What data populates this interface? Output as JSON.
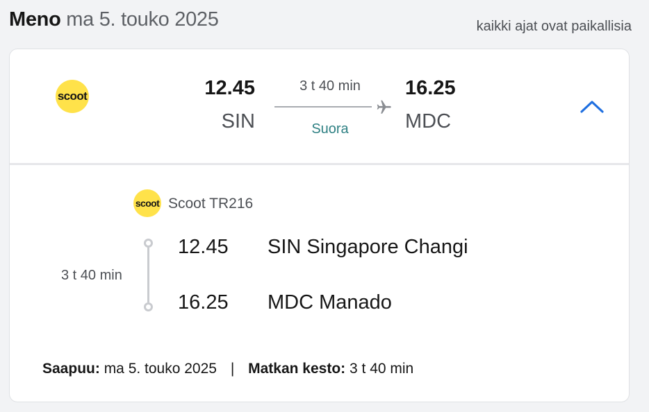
{
  "header": {
    "direction": "Meno",
    "date": "ma 5. touko 2025",
    "timezone_note": "kaikki ajat ovat paikallisia"
  },
  "summary": {
    "airline_logo_text": "scoot",
    "departure_time": "12.45",
    "departure_code": "SIN",
    "arrival_time": "16.25",
    "arrival_code": "MDC",
    "duration": "3 t 40 min",
    "stops": "Suora",
    "icons": {
      "route": "plane-icon",
      "toggle": "chevron-up-icon"
    }
  },
  "detail": {
    "carrier_logo_text": "scoot",
    "carrier": "Scoot TR216",
    "segment_duration": "3 t 40 min",
    "departure": {
      "time": "12.45",
      "airport": "SIN Singapore Changi"
    },
    "arrival": {
      "time": "16.25",
      "airport": "MDC Manado"
    }
  },
  "footer": {
    "arrives_label": "Saapuu:",
    "arrives_value": "ma 5. touko 2025",
    "separator": "|",
    "duration_label": "Matkan kesto:",
    "duration_value": "3 t 40 min"
  },
  "colors": {
    "background": "#f2f3f5",
    "card": "#ffffff",
    "logo_yellow": "#ffe24a",
    "stops_teal": "#2e8083",
    "chevron_blue": "#1f6fe0"
  }
}
